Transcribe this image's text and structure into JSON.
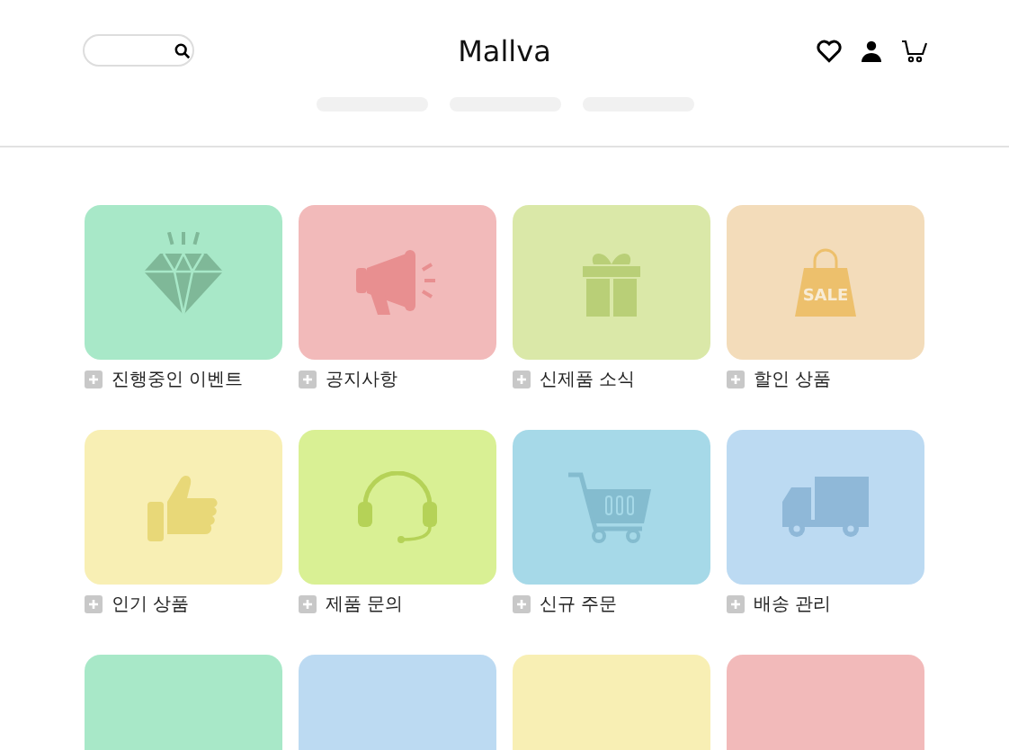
{
  "header": {
    "logo": "Mallva"
  },
  "tiles": [
    {
      "label": "진행중인 이벤트",
      "kind": "diamond",
      "color": "#a8e8c8"
    },
    {
      "label": "공지사항",
      "kind": "megaphone",
      "color": "#f2baba"
    },
    {
      "label": "신제품 소식",
      "kind": "gift",
      "color": "#dae8a8"
    },
    {
      "label": "할인 상품",
      "kind": "sale-bag",
      "icon_text": "SALE",
      "color": "#f3dcba"
    },
    {
      "label": "인기 상품",
      "kind": "thumb",
      "color": "#f8efb4"
    },
    {
      "label": "제품 문의",
      "kind": "headset",
      "color": "#d9f094"
    },
    {
      "label": "신규 주문",
      "kind": "cart",
      "color": "#a6d9e8"
    },
    {
      "label": "배송 관리",
      "kind": "truck",
      "color": "#bcdaf2"
    },
    {
      "kind": "none",
      "color": "#a8e8c8"
    },
    {
      "kind": "none",
      "color": "#bcdaf2"
    },
    {
      "kind": "none",
      "color": "#f8efb4"
    },
    {
      "kind": "none",
      "color": "#f2baba"
    }
  ]
}
